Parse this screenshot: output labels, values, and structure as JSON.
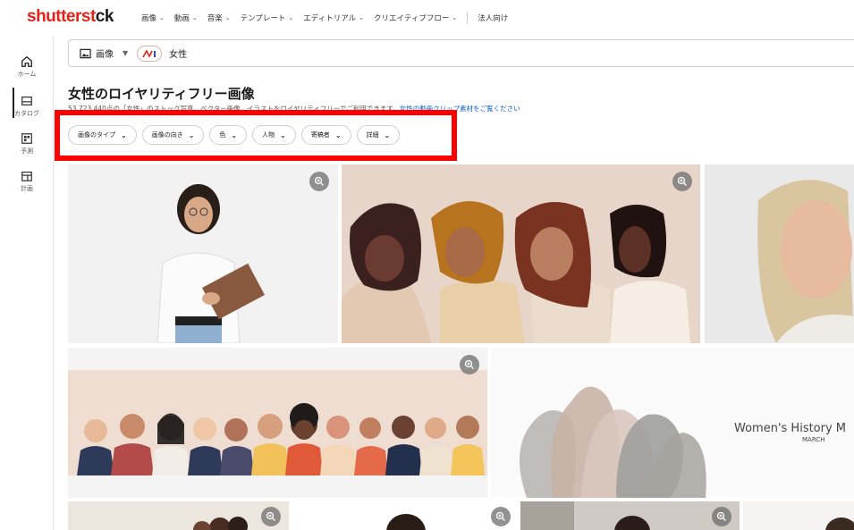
{
  "header": {
    "logo": {
      "part1": "shutterst",
      "part2": "ck"
    },
    "nav": [
      {
        "label": "画像",
        "has_chevron": true
      },
      {
        "label": "動画",
        "has_chevron": true
      },
      {
        "label": "音楽",
        "has_chevron": true
      },
      {
        "label": "テンプレート",
        "has_chevron": true
      },
      {
        "label": "エディトリアル",
        "has_chevron": true
      },
      {
        "label": "クリエイティブフロー",
        "has_chevron": true
      },
      {
        "label": "法人向け",
        "has_chevron": false
      }
    ]
  },
  "sidebar": {
    "items": [
      {
        "label": "ホーム",
        "icon": "home-icon",
        "active": true
      },
      {
        "label": "カタログ",
        "icon": "catalog-icon"
      },
      {
        "label": "予測",
        "icon": "forecast-icon"
      },
      {
        "label": "計画",
        "icon": "plan-icon"
      }
    ]
  },
  "search": {
    "media_type": "画像",
    "ai_icon": "ai-search-icon",
    "query": "女性"
  },
  "results": {
    "title": "女性のロイヤリティフリー画像",
    "subtitle": "53,723,440点の「女性」のストック写真、ベクター画像、イラストをロイヤリティフリーでご利用できます。",
    "video_link": "女性の動画クリップ素材をご覧ください"
  },
  "filters": [
    {
      "label": "画像のタイプ"
    },
    {
      "label": "画像の向き"
    },
    {
      "label": "色"
    },
    {
      "label": "人物"
    },
    {
      "label": "寄稿者"
    },
    {
      "label": "詳細"
    }
  ],
  "images": {
    "zoom_icon": "zoom-in-icon",
    "watermark": {
      "line1": "Women's History M",
      "line2": "MARCH"
    }
  },
  "colors": {
    "brand_red": "#e2231a",
    "highlight_box": "#ff0000",
    "link_blue": "#0c62c9"
  }
}
